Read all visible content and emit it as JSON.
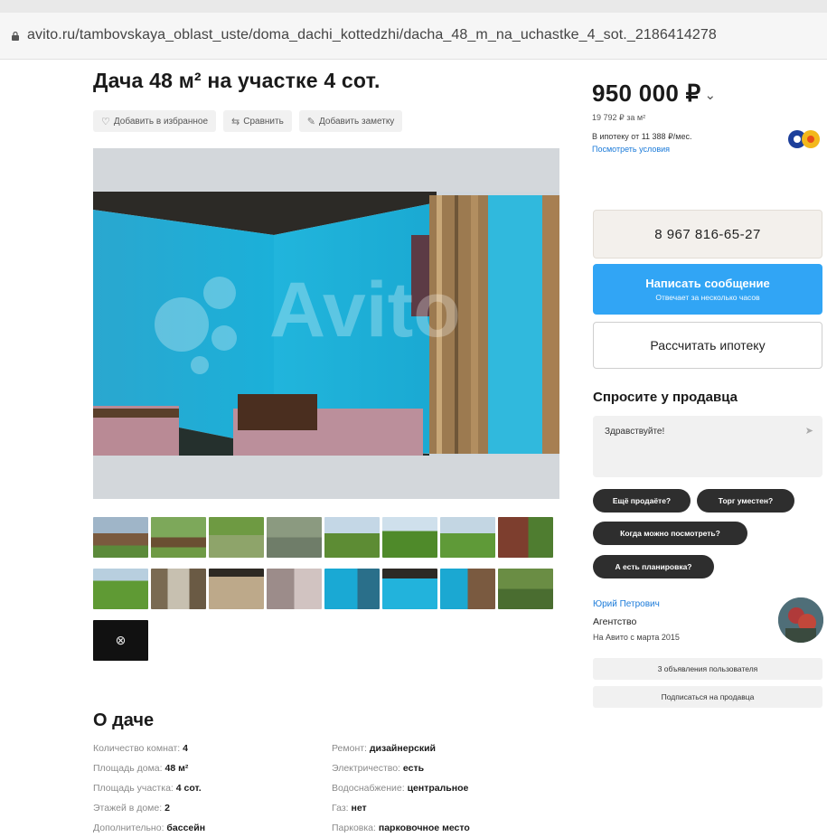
{
  "browser": {
    "url": "avito.ru/tambovskaya_oblast_uste/doma_dachi_kottedzhi/dacha_48_m_na_uchastke_4_sot._2186414278"
  },
  "listing": {
    "title": "Дача 48 м² на участке 4 сот.",
    "actions": {
      "favorite_label": "Добавить в избранное",
      "compare_label": "Сравнить",
      "note_label": "Добавить заметку"
    },
    "photo_watermark": "Avito",
    "thumbnail_count": 16,
    "video_thumb_icon": "play-icon"
  },
  "about": {
    "title": "О даче",
    "params_left": [
      {
        "key": "Количество комнат:",
        "value": "4"
      },
      {
        "key": "Площадь дома:",
        "value": "48 м²"
      },
      {
        "key": "Площадь участка:",
        "value": "4 сот."
      },
      {
        "key": "Этажей в доме:",
        "value": "2"
      },
      {
        "key": "Дополнительно:",
        "value": "бассейн"
      }
    ],
    "params_right": [
      {
        "key": "Ремонт:",
        "value": "дизайнерский"
      },
      {
        "key": "Электричество:",
        "value": "есть"
      },
      {
        "key": "Водоснабжение:",
        "value": "центральное"
      },
      {
        "key": "Газ:",
        "value": "нет"
      },
      {
        "key": "Парковка:",
        "value": "парковочное место"
      }
    ]
  },
  "pricing": {
    "price": "950 000 ₽",
    "price_per_m2": "19 792 ₽ за м²",
    "mortgage_text": "В ипотеку от 11 388 ₽/мес.",
    "mortgage_link": "Посмотреть условия"
  },
  "contact": {
    "phone_label": "8 967 816-65-27",
    "message_label": "Написать сообщение",
    "message_sub": "Отвечает за несколько часов",
    "mortgage_calc_label": "Рассчитать ипотеку"
  },
  "ask": {
    "title": "Спросите у продавца",
    "input_value": "Здравствуйте!",
    "chips": [
      "Ещё продаёте?",
      "Торг уместен?",
      "Когда можно посмотреть?",
      "А есть планировка?"
    ]
  },
  "seller": {
    "name": "Юрий Петрович",
    "type": "Агентство",
    "since": "На Авито с марта 2015",
    "listings_button": "3 объявления пользователя",
    "subscribe_button": "Подписаться на продавца"
  },
  "colors": {
    "accent_blue": "#31a5f5",
    "link_blue": "#1a7ad9",
    "chip_dark": "#2e2e2e",
    "wall_cyan": "#1ab2d8"
  }
}
